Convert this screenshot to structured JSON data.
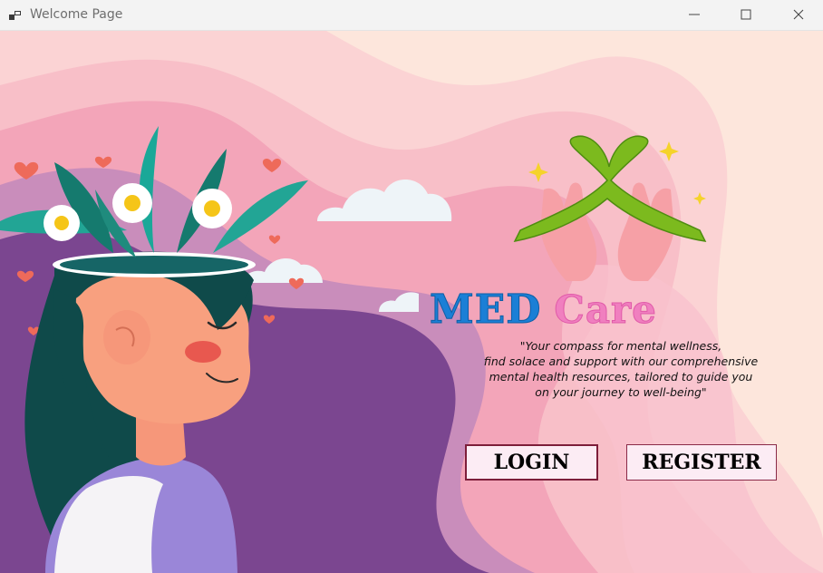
{
  "window": {
    "title": "Welcome Page"
  },
  "brand": {
    "part1": "MED",
    "part2": "Care"
  },
  "tagline": {
    "lines": [
      "\"Your compass for mental wellness,",
      "find solace and support with our comprehensive",
      "mental health resources, tailored to guide you",
      "on your journey to well-being\""
    ]
  },
  "buttons": {
    "login": "LOGIN",
    "register": "REGISTER"
  },
  "icons": {
    "app": "app-window-icon",
    "minimize": "minimize-icon",
    "maximize": "maximize-icon",
    "close": "close-icon",
    "ribbon": "awareness-ribbon-icon"
  },
  "colors": {
    "med_blue": "#1b7fd6",
    "care_pink": "#f07fbf",
    "button_border": "#7d1e3a",
    "button_fill": "#fcecf4",
    "purple_wave": "#7b4690",
    "ribbon_green": "#7cba1e"
  }
}
